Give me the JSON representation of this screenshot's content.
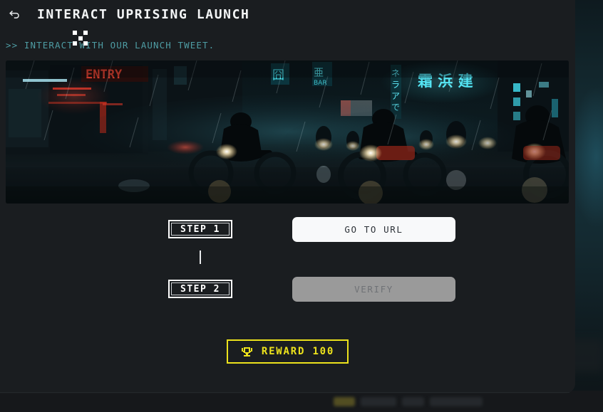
{
  "header": {
    "back_icon": "back-arrow-icon",
    "title": "INTERACT UPRISING LAUNCH"
  },
  "subtitle": {
    "prefix": ">>",
    "text": "INTERACT WITH OUR LAUNCH TWEET."
  },
  "cursor": {
    "icon": "crosshair-reticle-cursor"
  },
  "banner": {
    "alt": "Cyberpunk night street with motorcycle riders in rain and neon signage",
    "neon_texts": [
      "ENTRY",
      "BAR",
      "霜 浜 建"
    ]
  },
  "steps": [
    {
      "badge": "STEP 1",
      "action_label": "GO TO URL",
      "state": "enabled"
    },
    {
      "badge": "STEP 2",
      "action_label": "VERIFY",
      "state": "disabled"
    }
  ],
  "reward": {
    "icon": "trophy-icon",
    "label": "REWARD 100",
    "amount": 100
  },
  "colors": {
    "panel_bg": "#1a1d20",
    "page_bg": "#11171a",
    "title_text": "#f4f6f7",
    "subtitle_teal": "#4e9ca3",
    "primary_button_bg": "#f8f9fa",
    "primary_button_text": "#2d3238",
    "disabled_button_bg": "#9a9a9a",
    "disabled_button_text": "#6f7276",
    "reward_yellow": "#ece21c",
    "step_border": "#ffffff"
  }
}
